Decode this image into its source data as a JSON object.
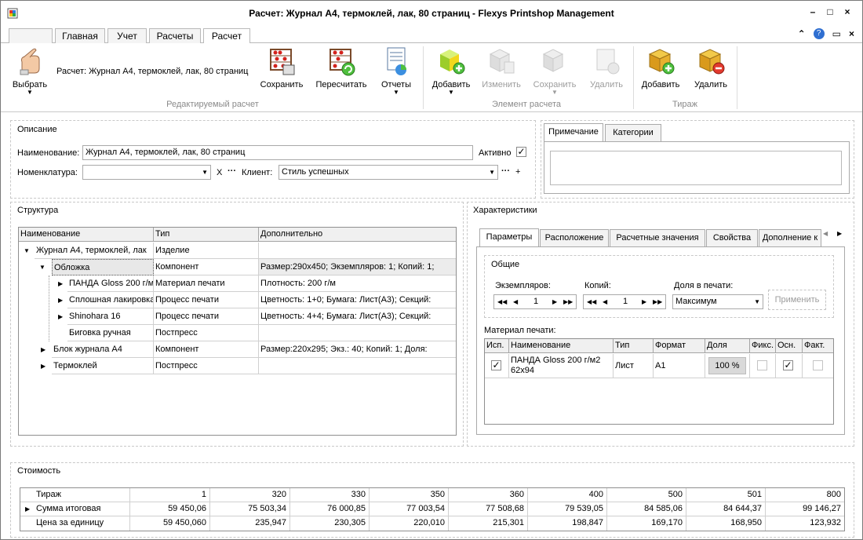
{
  "window": {
    "title": "Расчет: Журнал А4, термоклей, лак, 80 страниц - Flexys Printshop Management"
  },
  "ribbon_tabs": [
    "Главная",
    "Учет",
    "Расчеты",
    "Расчет"
  ],
  "ribbon": {
    "select_label": "Выбрать",
    "calc_name": "Расчет: Журнал А4, термоклей, лак, 80 страниц",
    "save_label": "Сохранить",
    "recalc_label": "Пересчитать",
    "reports_label": "Отчеты",
    "group_calc": "Редактируемый расчет",
    "add_label": "Добавить",
    "edit_label": "Изменить",
    "save2_label": "Сохранить",
    "delete_label": "Удалить",
    "group_element": "Элемент расчета",
    "tirazh_add": "Добавить",
    "tirazh_delete": "Удалить",
    "group_tirazh": "Тираж"
  },
  "description": {
    "title": "Описание",
    "name_label": "Наименование:",
    "name_value": "Журнал А4, термоклей, лак, 80 страниц",
    "active_label": "Активно",
    "nomenclature_label": "Номенклатура:",
    "nomenclature_clear": "X",
    "nomenclature_more": "···",
    "client_label": "Клиент:",
    "client_value": "Стиль успешных",
    "client_more": "···",
    "client_add": "+"
  },
  "notes": {
    "tabs": [
      "Примечание",
      "Категории"
    ]
  },
  "structure": {
    "title": "Структура",
    "columns": [
      "Наименование",
      "Тип",
      "Дополнительно"
    ],
    "rows": [
      {
        "name": "Журнал А4, термоклей, лак",
        "type": "Изделие",
        "extra": ""
      },
      {
        "name": "Обложка",
        "type": "Компонент",
        "extra": "Размер:290x450; Экземпляров: 1; Копий: 1;"
      },
      {
        "name": "ПАНДА Gloss 200 г/м",
        "type": "Материал печати",
        "extra": "Плотность: 200 г/м"
      },
      {
        "name": "Сплошная лакировка",
        "type": "Процесс печати",
        "extra": "Цветность: 1+0; Бумага: Лист(А3); Секций:"
      },
      {
        "name": "Shinohara 16",
        "type": "Процесс печати",
        "extra": "Цветность: 4+4; Бумага: Лист(А3); Секций:"
      },
      {
        "name": "Биговка ручная",
        "type": "Постпресс",
        "extra": ""
      },
      {
        "name": "Блок журнала А4",
        "type": "Компонент",
        "extra": "Размер:220x295; Экз.: 40; Копий: 1; Доля:"
      },
      {
        "name": "Термоклей",
        "type": "Постпресс",
        "extra": ""
      }
    ]
  },
  "characteristics": {
    "title": "Характеристики",
    "tabs": [
      "Параметры",
      "Расположение",
      "Расчетные значения",
      "Свойства",
      "Дополнение к"
    ],
    "general_title": "Общие",
    "copies_label": "Экземпляров:",
    "copies_value": "1",
    "kopii_label": "Копий:",
    "kopii_value": "1",
    "share_label": "Доля в печати:",
    "share_value": "Максимум",
    "apply_label": "Применить",
    "material_label": "Материал печати:",
    "material_columns": [
      "Исп.",
      "Наименование",
      "Тип",
      "Формат",
      "Доля",
      "Фикс.",
      "Осн.",
      "Факт."
    ],
    "material_row": {
      "name_line1": "ПАНДА Gloss 200 г/м2",
      "name_line2": "62x94",
      "type": "Лист",
      "format": "А1",
      "share": "100 %"
    }
  },
  "cost": {
    "title": "Стоимость",
    "rows": [
      {
        "label": "Тираж",
        "values": [
          "1",
          "320",
          "330",
          "350",
          "360",
          "400",
          "500",
          "501",
          "800"
        ]
      },
      {
        "label": "Сумма итоговая",
        "values": [
          "59 450,06",
          "75 503,34",
          "76 000,85",
          "77 003,54",
          "77 508,68",
          "79 539,05",
          "84 585,06",
          "84 644,37",
          "99 146,27"
        ]
      },
      {
        "label": "Цена за единицу",
        "values": [
          "59 450,060",
          "235,947",
          "230,305",
          "220,010",
          "215,301",
          "198,847",
          "169,170",
          "168,950",
          "123,932"
        ]
      }
    ]
  }
}
